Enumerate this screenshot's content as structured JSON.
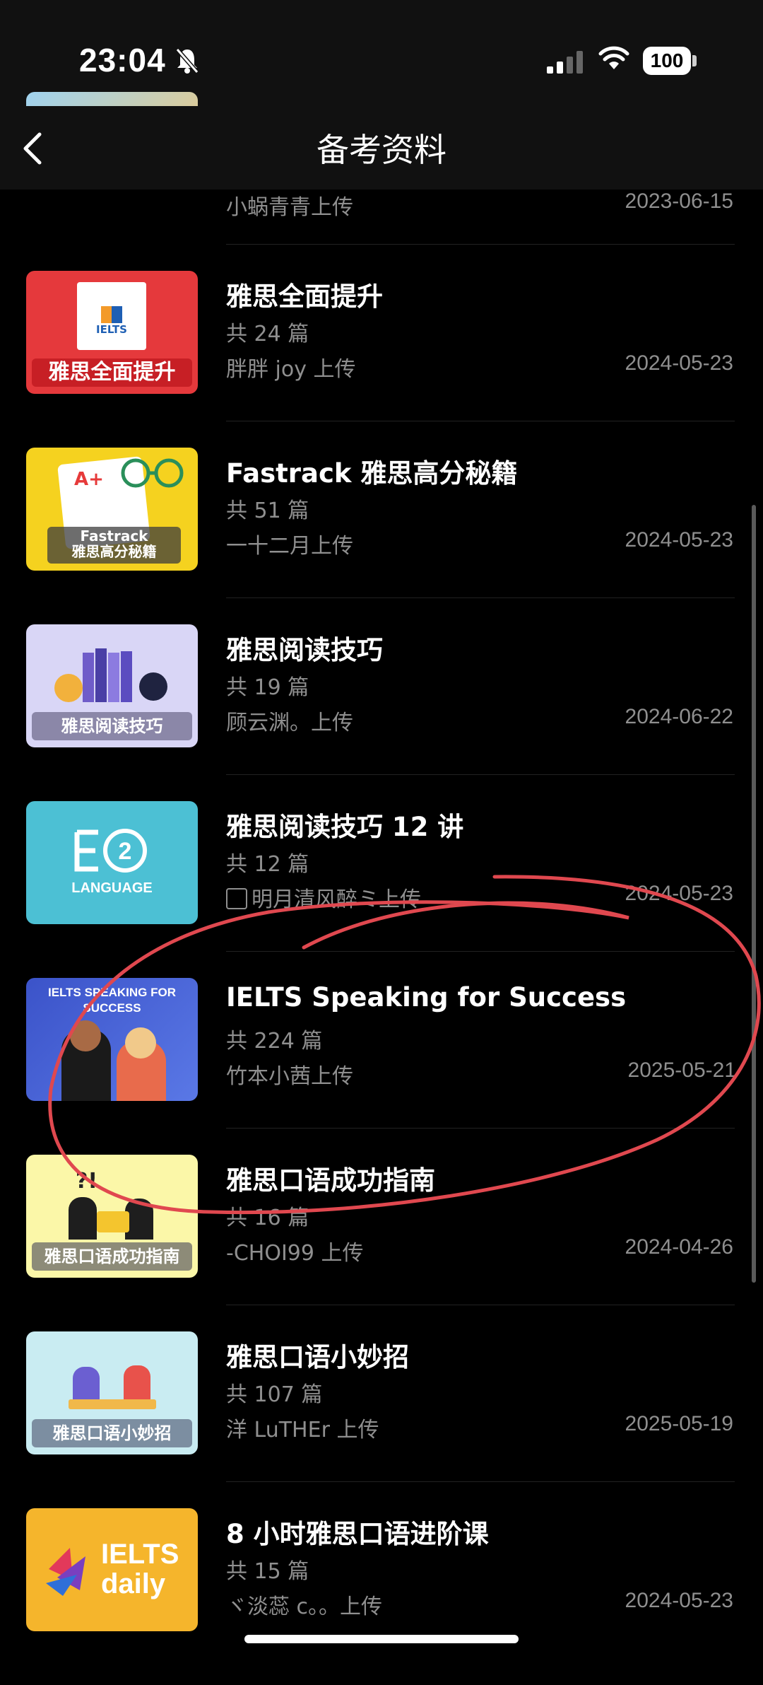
{
  "status_bar": {
    "time": "23:04",
    "battery": "100"
  },
  "header": {
    "title": "备考资料"
  },
  "partial_item": {
    "uploader": "小蜗青青上传",
    "date": "2023-06-15"
  },
  "items": [
    {
      "title": "雅思全面提升",
      "count": "共 24 篇",
      "uploader": "胖胖 joy 上传",
      "date": "2024-05-23",
      "thumb_text": "雅思全面提升",
      "thumb_logo": "IELTS"
    },
    {
      "title": "Fastrack 雅思高分秘籍",
      "count": "共 51 篇",
      "uploader": "一十二月上传",
      "date": "2024-05-23",
      "thumb_text": "Fastrack\n雅思高分秘籍"
    },
    {
      "title": "雅思阅读技巧",
      "count": "共 19 篇",
      "uploader": "顾云渊。上传",
      "date": "2024-06-22",
      "thumb_text": "雅思阅读技巧"
    },
    {
      "title": "雅思阅读技巧 12 讲",
      "count": "共 12 篇",
      "uploader": "明月清风醉ミ上传",
      "date": "2024-05-23",
      "thumb_text": "LANGUAGE"
    },
    {
      "title": "IELTS Speaking for Success",
      "count": "共 224 篇",
      "uploader": "竹本小茜上传",
      "date": "2025-05-21",
      "thumb_text": "IELTS SPEAKING FOR SUCCESS"
    },
    {
      "title": "雅思口语成功指南",
      "count": "共 16 篇",
      "uploader": "-CHOI99 上传",
      "date": "2024-04-26",
      "thumb_text": "雅思口语成功指南"
    },
    {
      "title": "雅思口语小妙招",
      "count": "共 107 篇",
      "uploader": "洋 LuTHEr 上传",
      "date": "2025-05-19",
      "thumb_text": "雅思口语小妙招"
    },
    {
      "title": "8 小时雅思口语进阶课",
      "count": "共 15 篇",
      "uploader": "ヾ淡蕊 c。。上传",
      "date": "2024-05-23",
      "thumb_text": "IELTS daily"
    }
  ],
  "colors": {
    "background": "#000000",
    "header_bg": "#111111",
    "annotation": "#e0484f",
    "secondary_text": "#8f8f8f"
  }
}
